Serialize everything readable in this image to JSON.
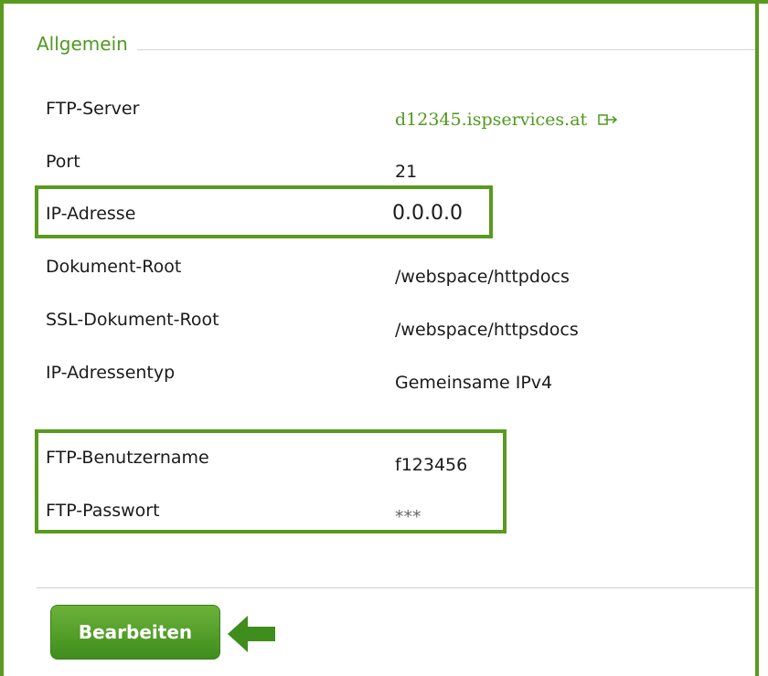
{
  "section": {
    "legend": "Allgemein"
  },
  "fields": [
    {
      "label": "FTP-Server",
      "value": "d12345.ispservices.at"
    },
    {
      "label": "Port",
      "value": "21"
    },
    {
      "label": "IP-Adresse",
      "value": "0.0.0.0"
    },
    {
      "label": "Dokument-Root",
      "value": "/webspace/httpdocs"
    },
    {
      "label": "SSL-Dokument-Root",
      "value": "/webspace/httpsdocs"
    },
    {
      "label": "IP-Adressentyp",
      "value": "Gemeinsame IPv4"
    },
    {
      "label": "FTP-Benutzername",
      "value": "f123456"
    },
    {
      "label": "FTP-Passwort",
      "value": "***"
    }
  ],
  "actions": {
    "edit_label": "Bearbeiten"
  },
  "icons": {
    "server_link": "external-link-icon",
    "pointer": "arrow-left-icon"
  },
  "colors": {
    "accent": "#5a9a1e",
    "link": "#4f9a1f",
    "button": "#4f9e2a"
  }
}
